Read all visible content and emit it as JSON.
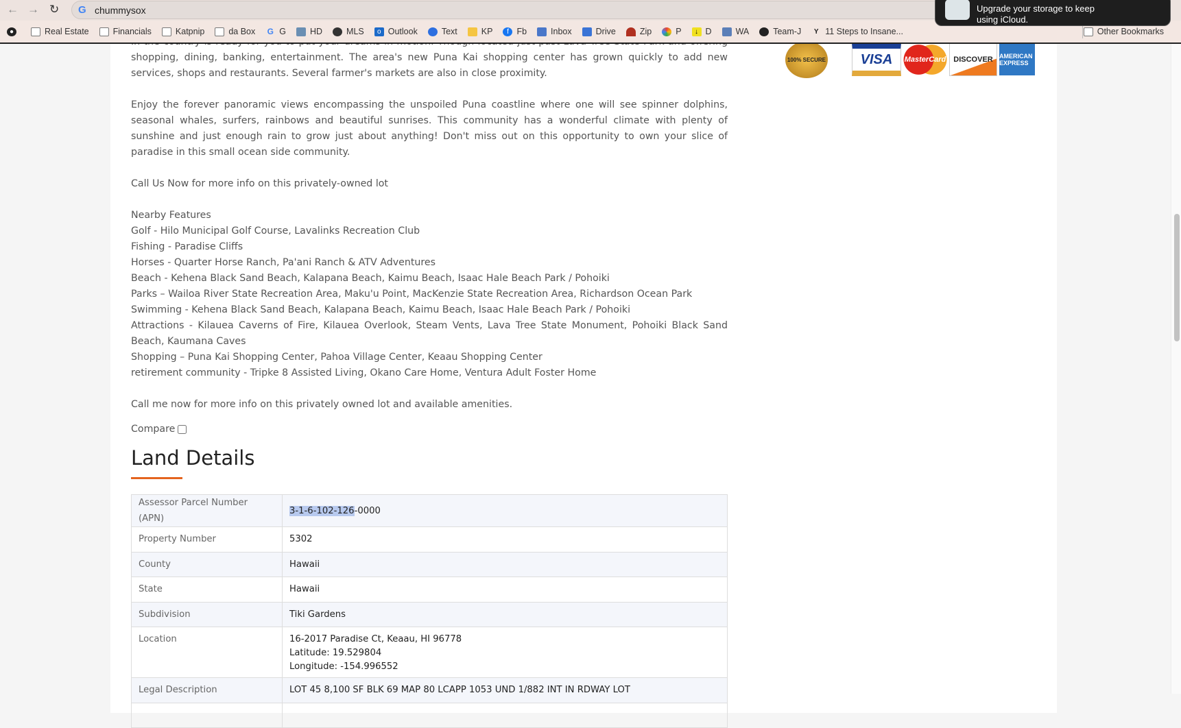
{
  "browser": {
    "url": "chummysox",
    "notification": "Upgrade your storage to keep using iCloud.",
    "bookmarks": [
      "Real Estate",
      "Financials",
      "Katpnip",
      "da Box",
      "G",
      "HD",
      "MLS",
      "Outlook",
      "Text",
      "KP",
      "Fb",
      "Inbox",
      "Drive",
      "Zip",
      "P",
      "D",
      "WA",
      "Team-J",
      "11 Steps to Insane..."
    ],
    "other_bookmarks": "Other Bookmarks"
  },
  "description": {
    "p1": "In the country is ready for you to put your dreams in motion. Though located just past Lava Tree State Park and offering shopping, dining, banking, entertainment. The area's new Puna Kai shopping center has grown quickly to add new services, shops and restaurants. Several farmer's markets are also in close proximity.",
    "p2": "Enjoy the forever panoramic views encompassing the unspoiled Puna coastline where one will see spinner dolphins, seasonal whales, surfers, rainbows and beautiful sunrises. This community has a wonderful climate with plenty of sunshine and just enough rain to grow just about anything! Don't miss out on this opportunity to own your slice of paradise in this small ocean side community.",
    "p3": "Call Us Now for more info on this privately-owned lot",
    "features_title": "Nearby Features",
    "features": [
      "Golf - Hilo Municipal Golf Course, Lavalinks Recreation Club",
      "Fishing - Paradise Cliffs",
      "Horses - Quarter Horse Ranch, Pa'ani Ranch & ATV Adventures",
      "Beach - Kehena Black Sand Beach, Kalapana Beach, Kaimu Beach, Isaac Hale Beach Park / Pohoiki",
      "Parks – Wailoa River State Recreation Area, Maku'u Point, MacKenzie State Recreation Area, Richardson Ocean Park",
      "Swimming - Kehena Black Sand Beach, Kalapana Beach, Kaimu Beach, Isaac Hale Beach Park / Pohoiki",
      "Attractions - Kilauea Caverns of Fire, Kilauea Overlook, Steam Vents, Lava Tree State Monument, Pohoiki Black Sand Beach, Kaumana Caves",
      "Shopping – Puna Kai Shopping Center, Pahoa Village Center, Keaau Shopping Center",
      "retirement community - Tripke 8 Assisted Living, Okano Care Home, Ventura Adult Foster Home"
    ],
    "p4": "Call me now for more info on this privately owned lot and available amenities."
  },
  "compare_label": "Compare",
  "land": {
    "title": "Land Details",
    "apn_label": "Assessor Parcel Number (APN)",
    "apn_selected": "3-1-6-102-126",
    "apn_rest": "-0000",
    "rows": [
      {
        "k": "Property Number",
        "v": "5302"
      },
      {
        "k": "County",
        "v": "Hawaii"
      },
      {
        "k": "State",
        "v": "Hawaii"
      },
      {
        "k": "Subdivision",
        "v": "Tiki Gardens"
      }
    ],
    "location_label": "Location",
    "address": "16-2017 Paradise Ct, Keaau, HI 96778",
    "latitude": "Latitude: 19.529804",
    "longitude": "Longitude: -154.996552",
    "legal_label": "Legal Description",
    "legal": "LOT 45 8,100 SF BLK 69 MAP 80 LCAPP 1053 UND 1/882 INT IN RDWAY LOT"
  },
  "payments": {
    "seal": "100% SECURE",
    "visa": "VISA",
    "mastercard": "MasterCard",
    "discover": "DISCOVER",
    "amex": "AMERICAN EXPRESS"
  }
}
